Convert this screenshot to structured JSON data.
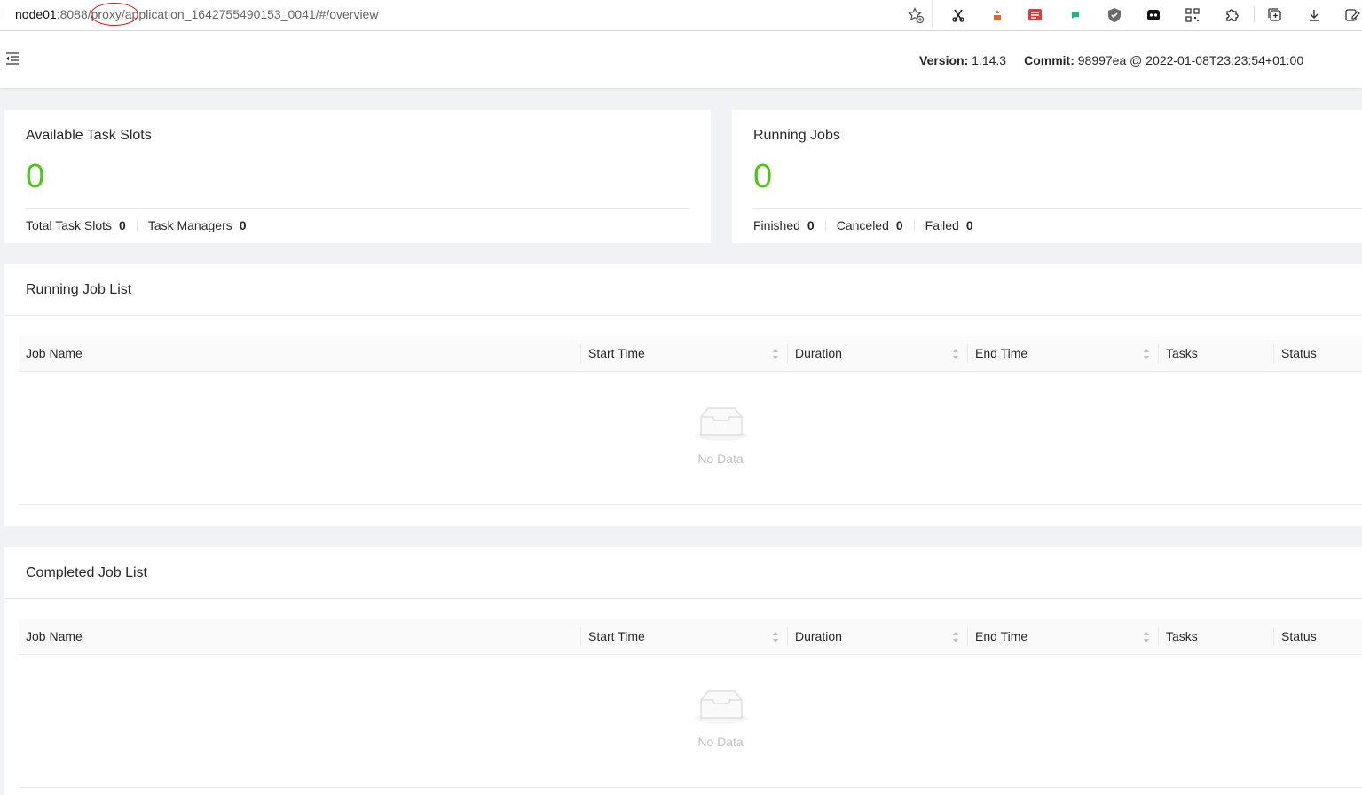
{
  "browser": {
    "url_host": "node01",
    "url_rest": ":8088/proxy/application_1642755490153_0041/#/overview",
    "icons": [
      "star-add-icon",
      "scissors-icon",
      "extension-orange-icon",
      "extension-red-icon",
      "extension-green-icon",
      "shield-icon",
      "extension-black-icon",
      "qr-icon",
      "puzzle-icon",
      "collections-icon",
      "download-icon",
      "edit-icon"
    ]
  },
  "header": {
    "version_label": "Version:",
    "version_value": "1.14.3",
    "commit_label": "Commit:",
    "commit_value": "98997ea @ 2022-01-08T23:23:54+01:00"
  },
  "task_slots_card": {
    "title": "Available Task Slots",
    "value": "0",
    "stats": [
      {
        "label": "Total Task Slots",
        "value": "0"
      },
      {
        "label": "Task Managers",
        "value": "0"
      }
    ]
  },
  "running_jobs_card": {
    "title": "Running Jobs",
    "value": "0",
    "stats": [
      {
        "label": "Finished",
        "value": "0"
      },
      {
        "label": "Canceled",
        "value": "0"
      },
      {
        "label": "Failed",
        "value": "0"
      }
    ]
  },
  "running_list": {
    "title": "Running Job List",
    "columns": [
      "Job Name",
      "Start Time",
      "Duration",
      "End Time",
      "Tasks",
      "Status"
    ],
    "empty_text": "No Data"
  },
  "completed_list": {
    "title": "Completed Job List",
    "columns": [
      "Job Name",
      "Start Time",
      "Duration",
      "End Time",
      "Tasks",
      "Status"
    ],
    "empty_text": "No Data"
  },
  "colors": {
    "accent_green": "#52c41a",
    "annotation_red": "#d0121b"
  }
}
